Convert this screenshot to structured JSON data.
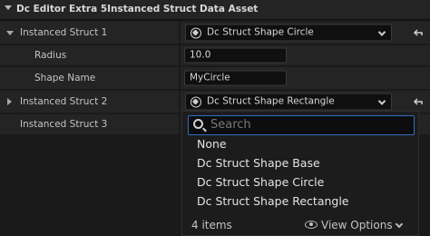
{
  "section": {
    "title": "Dc Editor Extra 5Instanced Struct Data Asset"
  },
  "rows": {
    "struct1": {
      "label": "Instanced Struct 1",
      "value": "Dc Struct Shape Circle"
    },
    "radius": {
      "label": "Radius",
      "value": "10.0"
    },
    "shape_name": {
      "label": "Shape Name",
      "value": "MyCircle"
    },
    "struct2": {
      "label": "Instanced Struct 2",
      "value": "Dc Struct Shape Rectangle"
    },
    "struct3": {
      "label": "Instanced Struct 3"
    }
  },
  "dropdown": {
    "search_placeholder": "Search",
    "options": [
      "None",
      "Dc Struct Shape Base",
      "Dc Struct Shape Circle",
      "Dc Struct Shape Rectangle"
    ],
    "item_count": "4 items",
    "view_options": "View Options"
  },
  "icons": {
    "section_expander": "chevron-down-icon",
    "struct": "struct-icon",
    "reset": "reset-arrow-icon",
    "search": "search-icon",
    "view": "eye-icon"
  }
}
